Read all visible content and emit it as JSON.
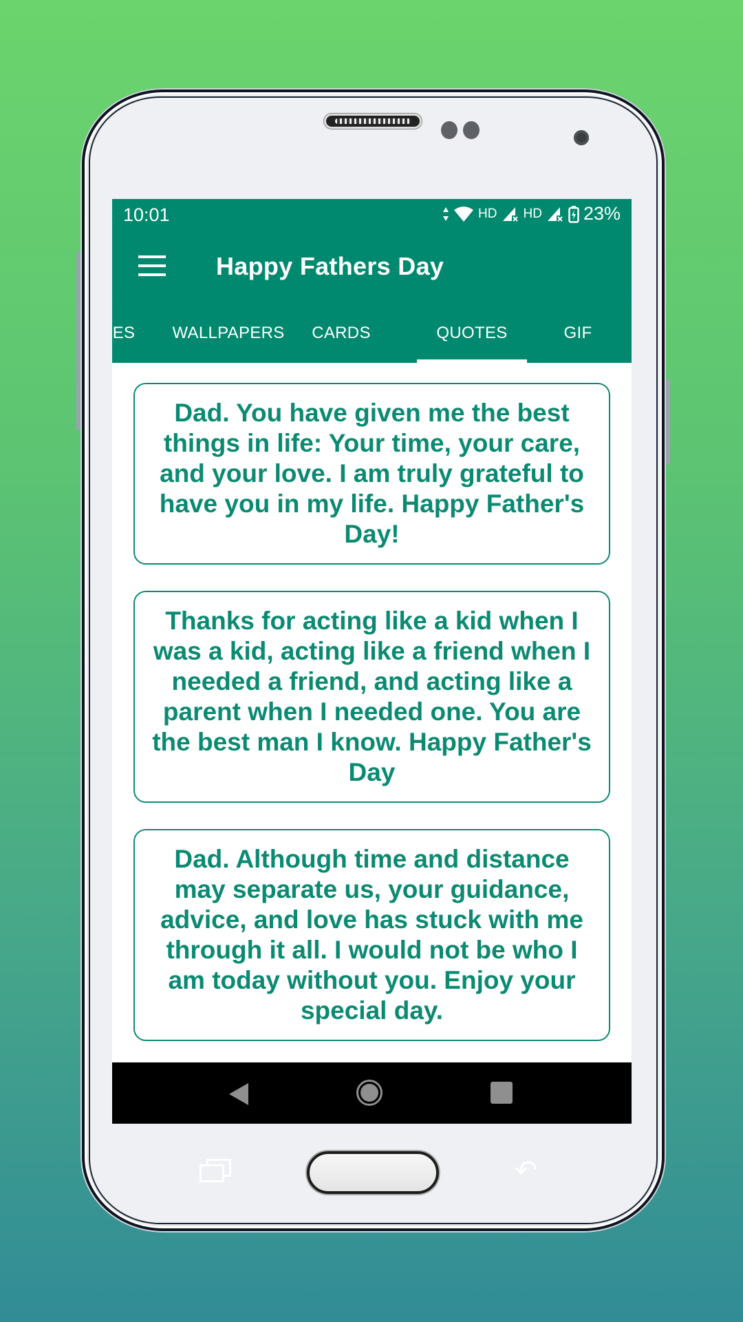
{
  "status_bar": {
    "time": "10:01",
    "icons": [
      "data-arrows-icon",
      "wifi-icon",
      "signal-icon",
      "signal-icon",
      "battery-charging-icon"
    ],
    "network_labels": [
      "HD",
      "HD"
    ],
    "battery": "23%"
  },
  "toolbar": {
    "menu_icon": "hamburger-menu-icon",
    "title": "Happy Fathers Day"
  },
  "tabs": [
    {
      "label": "ES",
      "active": false
    },
    {
      "label": "WALLPAPERS",
      "active": false
    },
    {
      "label": "CARDS",
      "active": false
    },
    {
      "label": "QUOTES",
      "active": true
    },
    {
      "label": "GIF",
      "active": false
    }
  ],
  "quotes": [
    {
      "text": "Dad. You have given me the best things in life: Your time, your care, and your love. I am truly grateful to have you in my life. Happy Father's Day!"
    },
    {
      "text": "Thanks for acting like a kid when I was a kid, acting like a friend when I needed a friend, and acting like a parent when I needed one. You are the best man I know. Happy Father's Day"
    },
    {
      "text": "Dad. Although time and distance may separate us, your guidance, advice, and love has stuck with me through it all. I would not be who I am today without you. Enjoy your special day."
    }
  ],
  "nav_bar": {
    "back": "back-triangle-icon",
    "home": "home-circle-icon",
    "recents": "recents-square-icon"
  },
  "colors": {
    "primary": "#00896E",
    "quote_text": "#0B8A72",
    "background_top": "#6CD46C",
    "background_bottom": "#318C96"
  }
}
